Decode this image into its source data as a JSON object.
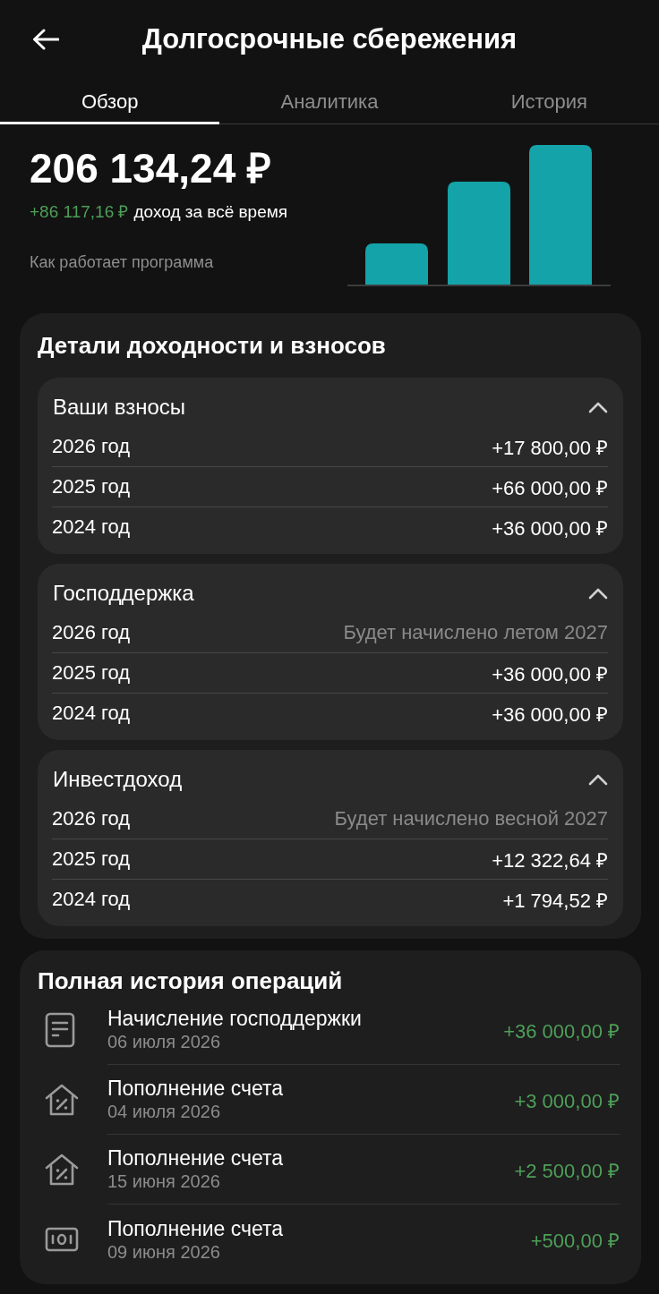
{
  "header": {
    "title": "Долгосрочные сбережения"
  },
  "tabs": [
    {
      "label": "Обзор",
      "selected": true
    },
    {
      "label": "Аналитика",
      "selected": false
    },
    {
      "label": "История",
      "selected": false
    }
  ],
  "summary": {
    "balance": "206 134,24 ₽",
    "income_amount": "+86 117,16 ₽",
    "income_label": "доход за всё время",
    "link": "Как работает программа"
  },
  "details": {
    "title": "Детали доходности и взносов",
    "groups": [
      {
        "title": "Ваши взносы",
        "expanded": true,
        "rows": [
          {
            "year": "2026 год",
            "kind": "amount",
            "value": "+17 800,00 ₽"
          },
          {
            "year": "2025 год",
            "kind": "amount",
            "value": "+66 000,00 ₽"
          },
          {
            "year": "2024 год",
            "kind": "amount",
            "value": "+36 000,00 ₽"
          }
        ]
      },
      {
        "title": "Господдержка",
        "expanded": true,
        "rows": [
          {
            "year": "2026 год",
            "kind": "pending",
            "value": "Будет начислено летом 2027"
          },
          {
            "year": "2025 год",
            "kind": "amount",
            "value": "+36 000,00 ₽"
          },
          {
            "year": "2024 год",
            "kind": "amount",
            "value": "+36 000,00 ₽"
          }
        ]
      },
      {
        "title": "Инвестдоход",
        "expanded": true,
        "rows": [
          {
            "year": "2026 год",
            "kind": "pending",
            "value": "Будет начислено весной 2027"
          },
          {
            "year": "2025 год",
            "kind": "amount",
            "value": "+12 322,64 ₽"
          },
          {
            "year": "2024 год",
            "kind": "amount",
            "value": "+1 794,52 ₽"
          }
        ]
      }
    ]
  },
  "history": {
    "title": "Полная история операций",
    "operations": [
      {
        "kind": "document",
        "title": "Начисление господдержки",
        "date": "06 июля 2026",
        "amount": "+36 000,00 ₽"
      },
      {
        "kind": "house_percent",
        "title": "Пополнение счета",
        "date": "04 июля 2026",
        "amount": "+3 000,00 ₽"
      },
      {
        "kind": "house_percent",
        "title": "Пополнение счета",
        "date": "15 июня 2026",
        "amount": "+2 500,00 ₽"
      },
      {
        "kind": "banknote",
        "title": "Пополнение счета",
        "date": "09 июня 2026",
        "amount": "+500,00 ₽"
      }
    ]
  }
}
